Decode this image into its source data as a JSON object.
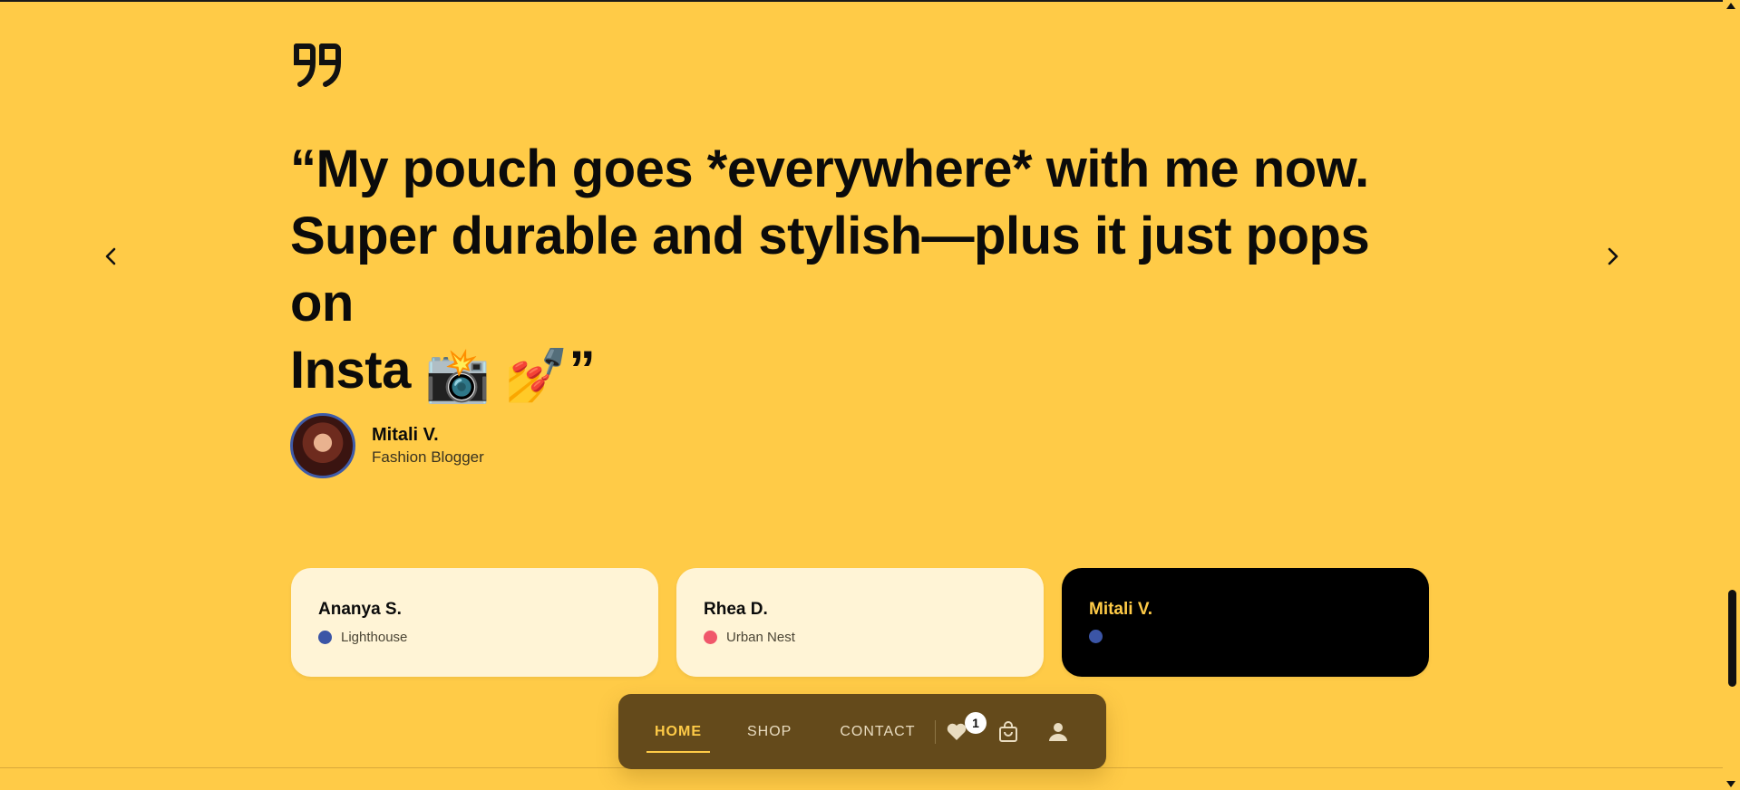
{
  "testimonial": {
    "quote_line1": "“My pouch goes *everywhere* with me now.",
    "quote_line2": "Super durable and stylish—plus it just pops on",
    "quote_line3_text": "Insta ",
    "emoji_camera": "📸",
    "emoji_nails": "💅",
    "quote_close": "”",
    "author_name": "Mitali V.",
    "author_role": "Fashion Blogger"
  },
  "icons": {
    "quote": "quote-icon",
    "prev": "chevron-left-icon",
    "next": "chevron-right-icon",
    "wishlist": "heart-icon",
    "cart": "shopping-bag-icon",
    "account": "user-icon"
  },
  "cards": [
    {
      "name": "Ananya S.",
      "brand": "Lighthouse",
      "dot_color": "#3B55A6"
    },
    {
      "name": "Rhea D.",
      "brand": "Urban Nest",
      "dot_color": "#F0576B"
    },
    {
      "name": "Mitali V.",
      "brand": "",
      "dot_color": "#3B55A6"
    }
  ],
  "nav": {
    "home": "HOME",
    "shop": "SHOP",
    "contact": "CONTACT",
    "wishlist_count": "1"
  },
  "colors": {
    "background": "#FFCB47",
    "nav_background": "#644A1B",
    "card_background": "#FFF4D6",
    "active_card": "#000000",
    "accent": "#FFCB47"
  }
}
